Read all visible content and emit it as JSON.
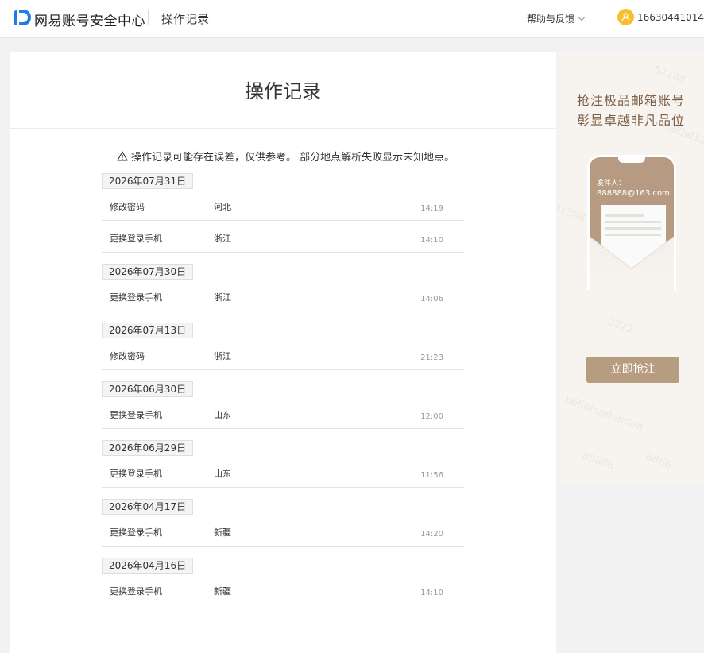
{
  "header": {
    "brand": "网易账号安全中心",
    "page_label": "操作记录",
    "help_label": "帮助与反馈",
    "username": "16630441014"
  },
  "main": {
    "title": "操作记录",
    "notice": "操作记录可能存在误差，仅供参考。 部分地点解析失败显示未知地点。",
    "groups": [
      {
        "date": "2026年07月31日",
        "records": [
          {
            "action": "修改密码",
            "location": "河北",
            "time": "14:19"
          },
          {
            "action": "更换登录手机",
            "location": "浙江",
            "time": "14:10"
          }
        ]
      },
      {
        "date": "2026年07月30日",
        "records": [
          {
            "action": "更换登录手机",
            "location": "浙江",
            "time": "14:06"
          }
        ]
      },
      {
        "date": "2026年07月13日",
        "records": [
          {
            "action": "修改密码",
            "location": "浙江",
            "time": "21:23"
          }
        ]
      },
      {
        "date": "2026年06月30日",
        "records": [
          {
            "action": "更换登录手机",
            "location": "山东",
            "time": "12:00"
          }
        ]
      },
      {
        "date": "2026年06月29日",
        "records": [
          {
            "action": "更换登录手机",
            "location": "山东",
            "time": "11:56"
          }
        ]
      },
      {
        "date": "2026年04月17日",
        "records": [
          {
            "action": "更换登录手机",
            "location": "新疆",
            "time": "14:20"
          }
        ]
      },
      {
        "date": "2026年04月16日",
        "records": [
          {
            "action": "更换登录手机",
            "location": "新疆",
            "time": "14:10"
          }
        ]
      }
    ]
  },
  "ad": {
    "line1": "抢注极品邮箱账号",
    "line2": "彰显卓越非凡品位",
    "sender_label": "发件人：",
    "sender_email": "888888@163.com",
    "button_label": "立即抢注",
    "watermarks": [
      "52188",
      "888bd12",
      "91388",
      "2222",
      "866bingdundun",
      "88888",
      "8866"
    ]
  },
  "colors": {
    "accent": "#1f7ee6",
    "avatar": "#f7be2d",
    "ad_text": "#7b5f47",
    "ad_button": "#b79d80",
    "ad_bg": "#f7f3ee"
  },
  "icons": {
    "logo": "netease-id-logo-icon",
    "help_dropdown": "chevron-down-icon",
    "user_dropdown": "chevron-down-icon",
    "avatar": "user-icon",
    "notice": "warning-icon"
  }
}
